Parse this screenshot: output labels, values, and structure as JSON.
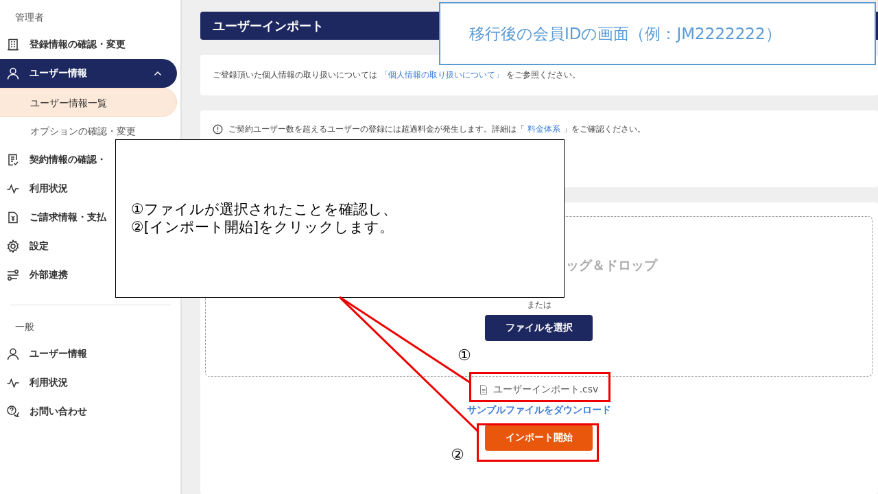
{
  "sidebar": {
    "sections": [
      {
        "heading": "管理者",
        "items": [
          {
            "label": "登録情報の確認・変更",
            "selected": false
          },
          {
            "label": "ユーザー情報",
            "selected": true,
            "expanded": true,
            "children": [
              {
                "label": "ユーザー情報一覧",
                "selected": true
              },
              {
                "label": "オプションの確認・変更",
                "selected": false
              }
            ]
          },
          {
            "label": "契約情報の確認・",
            "selected": false
          },
          {
            "label": "利用状況",
            "selected": false
          },
          {
            "label": "ご請求情報・支払",
            "selected": false
          },
          {
            "label": "設定",
            "selected": false
          },
          {
            "label": "外部連携",
            "selected": false
          }
        ]
      },
      {
        "heading": "一般",
        "items": [
          {
            "label": "ユーザー情報",
            "selected": false
          },
          {
            "label": "利用状況",
            "selected": false
          },
          {
            "label": "お問い合わせ",
            "selected": false
          }
        ]
      }
    ]
  },
  "page": {
    "title": "ユーザーインポート",
    "privacy_notice": {
      "before": "ご登録頂いた個人情報の取り扱いについては ",
      "link": "「個人情報の取り扱いについて」",
      "after": " をご参照ください。"
    },
    "fee_notice": {
      "before": "ご契約ユーザー数を超えるユーザーの登録には超過料金が発生します。詳細は「 ",
      "link": "料金体系",
      "after": " 」をご確認ください。"
    },
    "dropzone": {
      "title": "ッグ＆ドロップ",
      "or": "または",
      "button": "ファイルを選択"
    },
    "selected_file": "ユーザーインポート.csv",
    "sample_link": "サンプルファイルをダウンロード",
    "import_button": "インポート開始"
  },
  "annotations": {
    "caption": "移行後の会員IDの画面（例：JM2222222）",
    "callout": [
      "①ファイルが選択されたことを確認し、",
      "②[インポート開始]をクリックします。"
    ],
    "markers": [
      "①",
      "②"
    ]
  }
}
